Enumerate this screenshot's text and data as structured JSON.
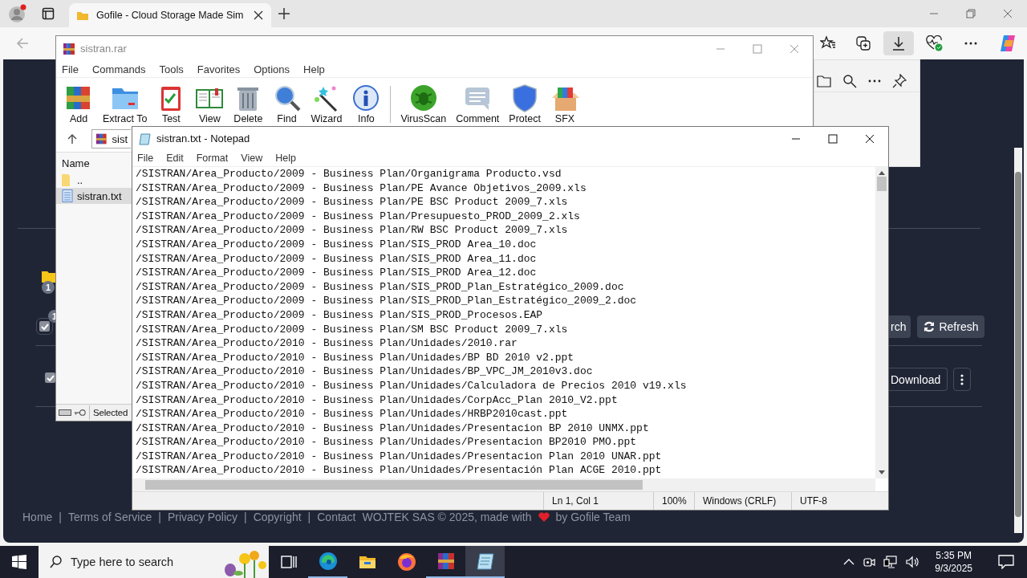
{
  "browser": {
    "tab": {
      "title": "Gofile - Cloud Storage Made Sim",
      "selected": true
    }
  },
  "page": {
    "badges": [
      "1",
      "1"
    ],
    "checkboxes": [
      {
        "checked": true
      },
      {
        "checked": true
      }
    ],
    "buttons": [
      {
        "label": "rch",
        "kind": "plain"
      },
      {
        "label": "Refresh",
        "kind": "refresh"
      }
    ],
    "download": "Download",
    "footer_links": [
      "Home",
      "Terms of Service",
      "Privacy Policy",
      "Copyright",
      "Contact"
    ],
    "footer_separators": [
      "|",
      "|",
      "|",
      "|"
    ],
    "footer_credit": [
      "WOJTEK SAS © 2025, made with",
      "by Gofile Team"
    ]
  },
  "winrar": {
    "title": "sistran.rar",
    "menu": [
      "File",
      "Commands",
      "Tools",
      "Favorites",
      "Options",
      "Help"
    ],
    "toolbar": [
      {
        "label": "Add",
        "kind": "add"
      },
      {
        "label": "Extract To",
        "kind": "extract"
      },
      {
        "label": "Test",
        "kind": "test"
      },
      {
        "label": "View",
        "kind": "view"
      },
      {
        "label": "Delete",
        "kind": "delete"
      },
      {
        "label": "Find",
        "kind": "find"
      },
      {
        "label": "Wizard",
        "kind": "wizard"
      },
      {
        "label": "Info",
        "kind": "info"
      },
      {
        "label": "VirusScan",
        "kind": "virus"
      },
      {
        "label": "Comment",
        "kind": "comment"
      },
      {
        "label": "Protect",
        "kind": "protect"
      },
      {
        "label": "SFX",
        "kind": "sfx"
      }
    ],
    "address": "sist",
    "column": "Name",
    "files": [
      {
        "name": "..",
        "kind": "folder",
        "selected": false
      },
      {
        "name": "sistran.txt",
        "kind": "text",
        "selected": true
      }
    ],
    "status": "Selected"
  },
  "notepad": {
    "title": "sistran.txt - Notepad",
    "menu": [
      "File",
      "Edit",
      "Format",
      "View",
      "Help"
    ],
    "lines": [
      "/SISTRAN/Area_Producto/2009 - Business Plan/Organigrama Producto.vsd",
      "/SISTRAN/Area_Producto/2009 - Business Plan/PE Avance Objetivos_2009.xls",
      "/SISTRAN/Area_Producto/2009 - Business Plan/PE BSC Product 2009_7.xls",
      "/SISTRAN/Area_Producto/2009 - Business Plan/Presupuesto_PROD_2009_2.xls",
      "/SISTRAN/Area_Producto/2009 - Business Plan/RW BSC Product 2009_7.xls",
      "/SISTRAN/Area_Producto/2009 - Business Plan/SIS_PROD Area_10.doc",
      "/SISTRAN/Area_Producto/2009 - Business Plan/SIS_PROD Area_11.doc",
      "/SISTRAN/Area_Producto/2009 - Business Plan/SIS_PROD Area_12.doc",
      "/SISTRAN/Area_Producto/2009 - Business Plan/SIS_PROD_Plan_Estratégico_2009.doc",
      "/SISTRAN/Area_Producto/2009 - Business Plan/SIS_PROD_Plan_Estratégico_2009_2.doc",
      "/SISTRAN/Area_Producto/2009 - Business Plan/SIS_PROD_Procesos.EAP",
      "/SISTRAN/Area_Producto/2009 - Business Plan/SM BSC Product 2009_7.xls",
      "/SISTRAN/Area_Producto/2010 - Business Plan/Unidades/2010.rar",
      "/SISTRAN/Area_Producto/2010 - Business Plan/Unidades/BP BD 2010 v2.ppt",
      "/SISTRAN/Area_Producto/2010 - Business Plan/Unidades/BP_VPC_JM_2010v3.doc",
      "/SISTRAN/Area_Producto/2010 - Business Plan/Unidades/Calculadora de Precios 2010 v19.xls",
      "/SISTRAN/Area_Producto/2010 - Business Plan/Unidades/CorpAcc_Plan 2010_V2.ppt",
      "/SISTRAN/Area_Producto/2010 - Business Plan/Unidades/HRBP2010cast.ppt",
      "/SISTRAN/Area_Producto/2010 - Business Plan/Unidades/Presentacion BP 2010 UNMX.ppt",
      "/SISTRAN/Area_Producto/2010 - Business Plan/Unidades/Presentacion BP2010 PMO.ppt",
      "/SISTRAN/Area_Producto/2010 - Business Plan/Unidades/Presentacion Plan 2010 UNAR.ppt",
      "/SISTRAN/Area_Producto/2010 - Business Plan/Unidades/Presentación Plan ACGE 2010.ppt"
    ],
    "status": [
      "Ln 1, Col 1",
      "100%",
      "Windows (CRLF)",
      "UTF-8"
    ]
  },
  "taskbar": {
    "search_placeholder": "Type here to search",
    "apps": [
      {
        "kind": "taskview",
        "running": false,
        "selected": false
      },
      {
        "kind": "edge",
        "running": true,
        "selected": false
      },
      {
        "kind": "explorer",
        "running": false,
        "selected": false
      },
      {
        "kind": "firefox",
        "running": false,
        "selected": false
      },
      {
        "kind": "winrar",
        "running": true,
        "selected": false
      },
      {
        "kind": "notepad",
        "running": true,
        "selected": true
      }
    ],
    "time": "5:35 PM",
    "date": "9/3/2025"
  }
}
